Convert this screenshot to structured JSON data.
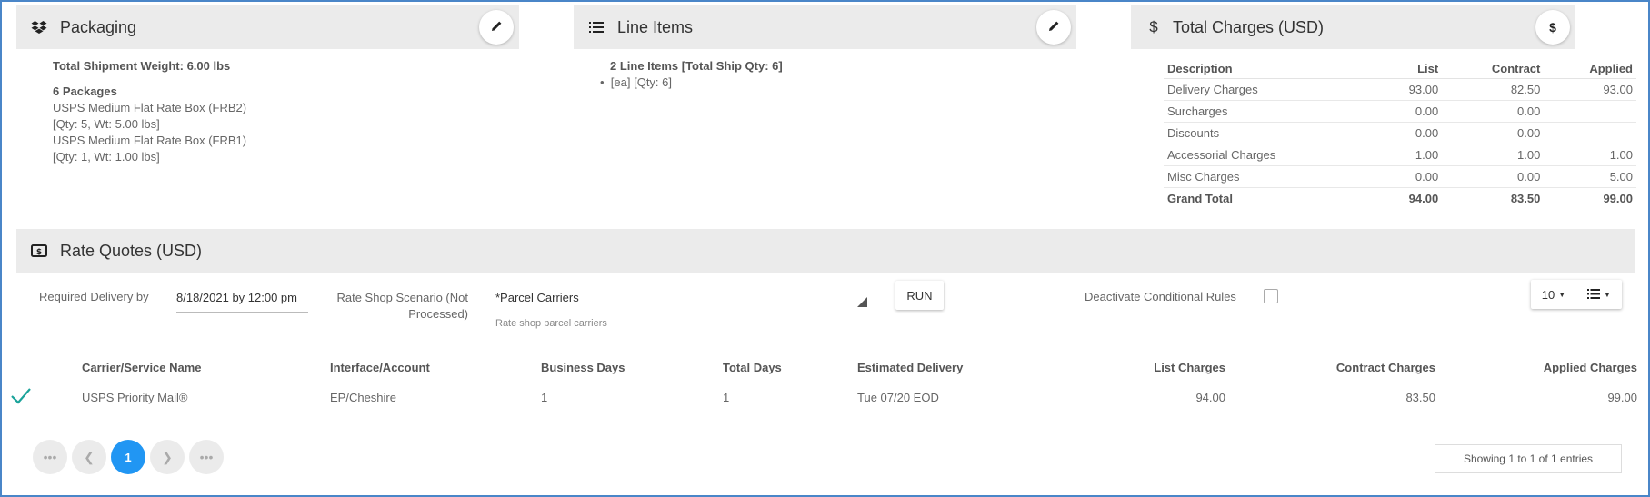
{
  "packaging": {
    "title": "Packaging",
    "total_weight": "Total Shipment Weight: 6.00 lbs",
    "packages_count": "6 Packages",
    "lines": [
      "USPS Medium Flat Rate Box (FRB2)",
      "[Qty: 5, Wt: 5.00 lbs]",
      "USPS Medium Flat Rate Box (FRB1)",
      "[Qty: 1, Wt: 1.00 lbs]"
    ]
  },
  "line_items": {
    "title": "Line Items",
    "summary": "2 Line Items [Total Ship Qty: 6]",
    "bullet": "[ea] [Qty: 6]"
  },
  "total_charges": {
    "title": "Total Charges (USD)",
    "edit_glyph": "$",
    "headers": [
      "Description",
      "List",
      "Contract",
      "Applied"
    ],
    "rows": [
      {
        "description": "Delivery Charges",
        "list": "93.00",
        "contract": "82.50",
        "applied": "93.00"
      },
      {
        "description": "Surcharges",
        "list": "0.00",
        "contract": "0.00",
        "applied": ""
      },
      {
        "description": "Discounts",
        "list": "0.00",
        "contract": "0.00",
        "applied": ""
      },
      {
        "description": "Accessorial Charges",
        "list": "1.00",
        "contract": "1.00",
        "applied": "1.00"
      },
      {
        "description": "Misc Charges",
        "list": "0.00",
        "contract": "0.00",
        "applied": "5.00"
      },
      {
        "description": "Grand Total",
        "list": "94.00",
        "contract": "83.50",
        "applied": "99.00"
      }
    ]
  },
  "rate_quotes": {
    "title": "Rate Quotes (USD)",
    "required_delivery_label": "Required Delivery by",
    "required_delivery_value": "8/18/2021 by 12:00 pm",
    "scenario_label_1": "Rate Shop Scenario (Not",
    "scenario_label_2": "Processed)",
    "scenario_value": "*Parcel Carriers",
    "scenario_hint": "Rate shop parcel carriers",
    "run_label": "RUN",
    "deactivate_label": "Deactivate Conditional Rules",
    "page_size": "10",
    "columns": [
      "Carrier/Service Name",
      "Interface/Account",
      "Business Days",
      "Total Days",
      "Estimated Delivery",
      "List Charges",
      "Contract Charges",
      "Applied Charges"
    ],
    "rows": [
      {
        "carrier": "USPS Priority Mail®",
        "account": "EP/Cheshire",
        "business_days": "1",
        "total_days": "1",
        "estimated_delivery": "Tue 07/20 EOD",
        "list": "94.00",
        "contract": "83.50",
        "applied": "99.00"
      }
    ],
    "current_page": "1",
    "entries_text": "Showing 1 to 1 of 1 entries"
  },
  "colors": {
    "accent": "#1e90e6",
    "active_page": "#2196f3",
    "check": "#1aa39a",
    "header_bg": "#ebebeb"
  }
}
